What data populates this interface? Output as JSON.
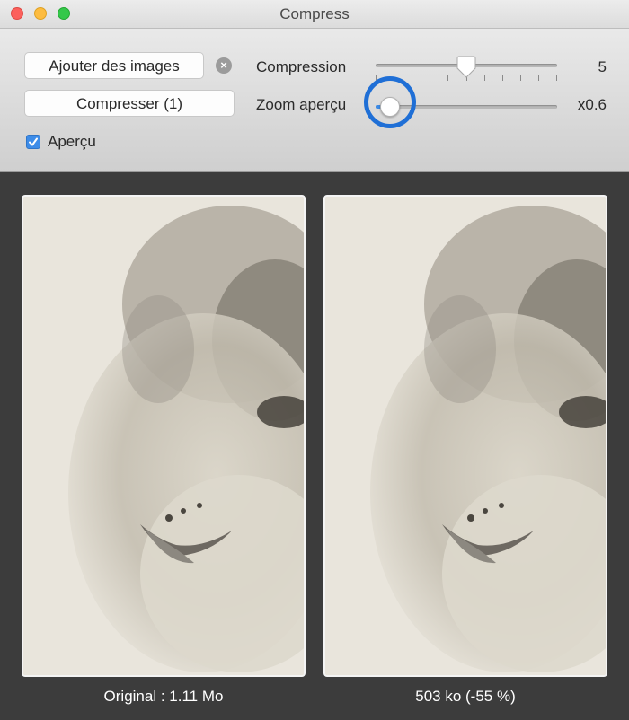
{
  "window": {
    "title": "Compress"
  },
  "toolbar": {
    "add_images_label": "Ajouter des images",
    "compress_label": "Compresser (1)",
    "preview_label": "Aperçu",
    "preview_checked": true,
    "compression": {
      "label": "Compression",
      "value_text": "5",
      "value": 5,
      "min": 0,
      "max": 10
    },
    "zoom": {
      "label": "Zoom aperçu",
      "value_text": "x0.6",
      "fraction": 0.08
    }
  },
  "previews": {
    "original_caption": "Original : 1.11 Mo",
    "compressed_caption": "503 ko (-55 %)"
  },
  "colors": {
    "accent": "#3d8ce8",
    "highlight": "#1f6fd6",
    "background": "#3c3c3c"
  },
  "icons": [
    "clear-icon",
    "checkmark-icon",
    "slider-knob-icon"
  ]
}
